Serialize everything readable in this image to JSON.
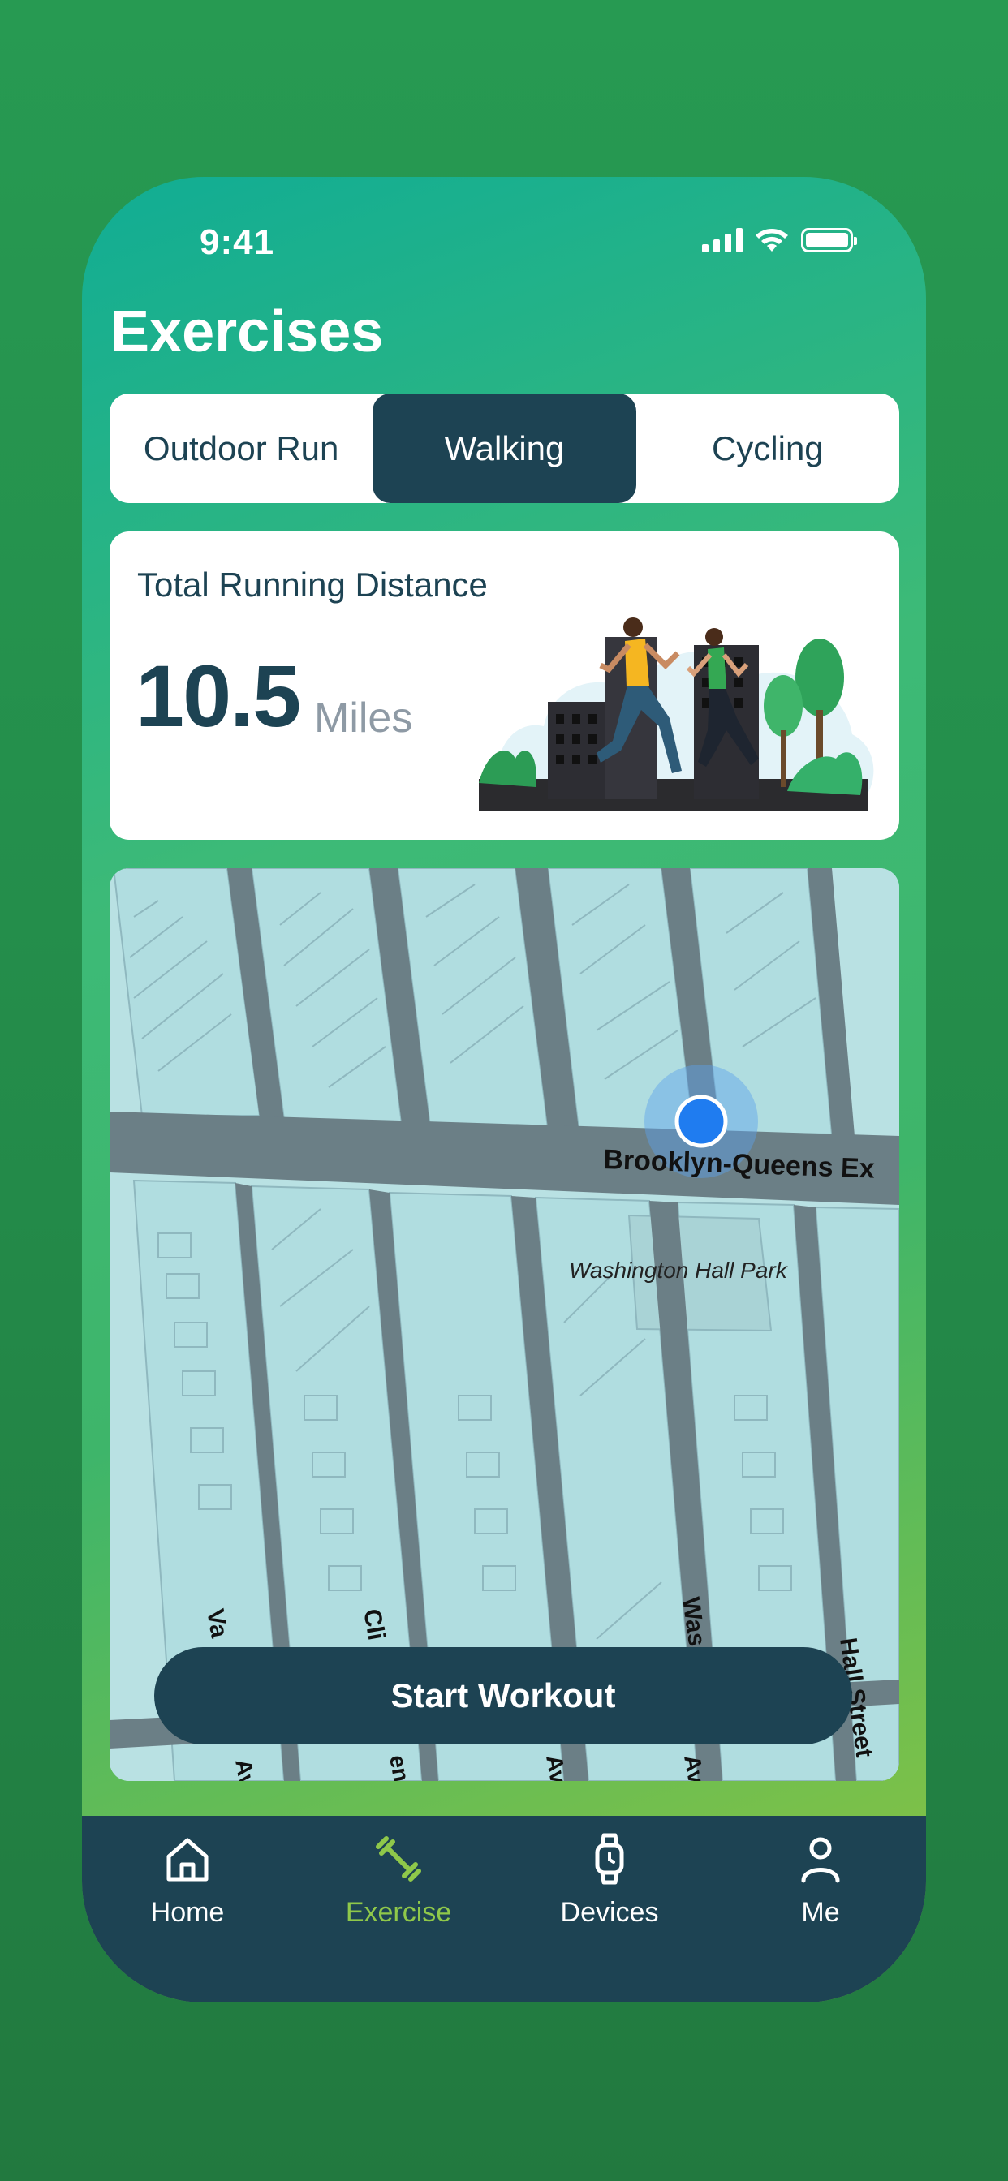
{
  "status_bar": {
    "time": "9:41"
  },
  "header": {
    "title": "Exercises"
  },
  "tabs": [
    {
      "label": "Outdoor Run",
      "active": false
    },
    {
      "label": "Walking",
      "active": true
    },
    {
      "label": "Cycling",
      "active": false
    }
  ],
  "distance_card": {
    "label": "Total Running Distance",
    "value": "10.5",
    "unit": "Miles",
    "illustration": "two-runners-city-park"
  },
  "map": {
    "labels": {
      "expressway": "Brooklyn-Queens Ex",
      "park": "Washington Hall Park",
      "street_1": "Va",
      "street_2": "Cli",
      "street_3": "Was",
      "street_4": "Hall Street",
      "street_5": "Av",
      "street_6": "enu",
      "street_7": "Av",
      "street_8": "Av"
    },
    "location_marker": "current-location"
  },
  "actions": {
    "start_workout": "Start Workout"
  },
  "bottom_nav": [
    {
      "label": "Home",
      "icon": "home-icon",
      "active": false
    },
    {
      "label": "Exercise",
      "icon": "dumbbell-icon",
      "active": true
    },
    {
      "label": "Devices",
      "icon": "watch-icon",
      "active": false
    },
    {
      "label": "Me",
      "icon": "user-icon",
      "active": false
    }
  ],
  "colors": {
    "primary_dark": "#1d4353",
    "accent_green": "#8fc84a",
    "location_blue": "#1f7cf0",
    "map_block": "#b9e1e3",
    "map_road": "#6b7f86"
  }
}
